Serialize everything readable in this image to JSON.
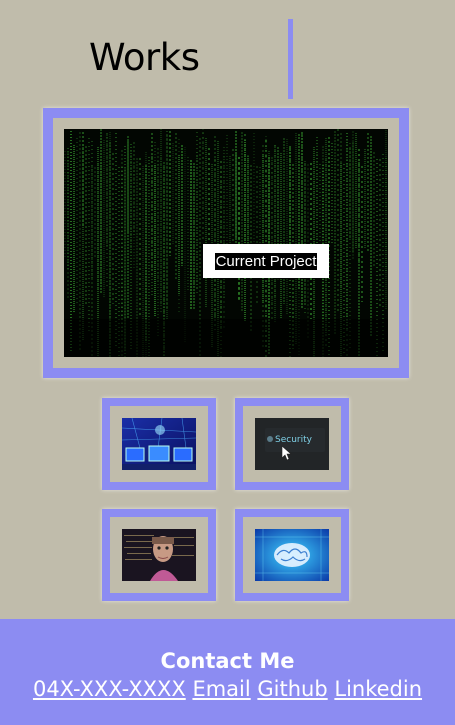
{
  "header": {
    "title": "Works"
  },
  "featured": {
    "label": "Current Project",
    "image_icon": "matrix-code-image"
  },
  "thumbnails": [
    {
      "icon": "monitors-network-image"
    },
    {
      "icon": "security-key-image"
    },
    {
      "icon": "robot-face-image"
    },
    {
      "icon": "digital-brain-image"
    }
  ],
  "footer": {
    "title": "Contact Me",
    "links": {
      "phone": "04X-XXX-XXXX",
      "email": "Email",
      "github": "Github",
      "linkedin": "Linkedin"
    }
  },
  "colors": {
    "background": "#c0bcab",
    "accent": "#8c8cf2",
    "footer_text": "#ffffff"
  }
}
